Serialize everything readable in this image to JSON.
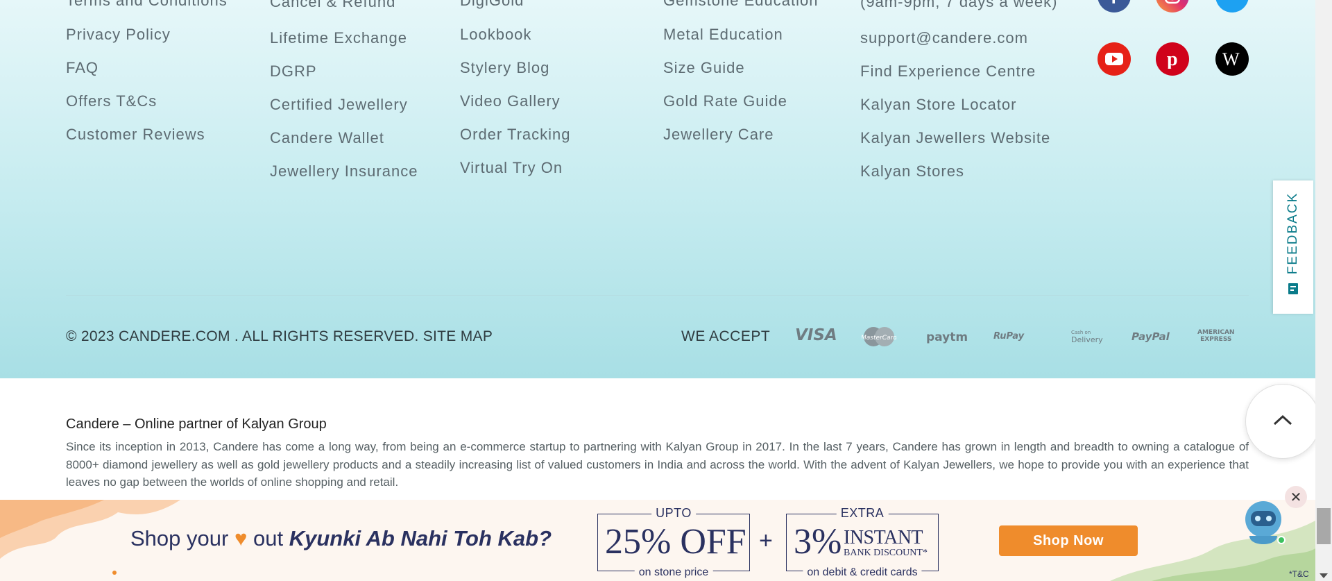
{
  "footer": {
    "columns": [
      {
        "id": "policies",
        "links": [
          "Terms and Conditions",
          "Privacy Policy",
          "FAQ",
          "Offers T&Cs",
          "Customer Reviews"
        ]
      },
      {
        "id": "services",
        "links": [
          "Cancel & Refund",
          "Lifetime Exchange",
          "DGRP",
          "Certified Jewellery",
          "Candere Wallet",
          "Jewellery Insurance"
        ]
      },
      {
        "id": "explore",
        "links": [
          "DigiGold",
          "Lookbook",
          "Stylery Blog",
          "Video Gallery",
          "Order Tracking",
          "Virtual Try On"
        ]
      },
      {
        "id": "education",
        "links": [
          "Gemstone Education",
          "Metal Education",
          "Size Guide",
          "Gold Rate Guide",
          "Jewellery Care"
        ]
      },
      {
        "id": "contact",
        "links": [
          "(9am-9pm, 7 days a week)",
          "support@candere.com",
          "Find Experience Centre",
          "Kalyan Store Locator",
          "Kalyan Jewellers Website",
          "Kalyan Stores"
        ]
      }
    ],
    "social": [
      {
        "name": "facebook-icon",
        "color": "#3b5998"
      },
      {
        "name": "instagram-icon",
        "color": "#e1306c"
      },
      {
        "name": "twitter-icon",
        "color": "#1da1f2"
      },
      {
        "name": "youtube-icon",
        "color": "#e62117"
      },
      {
        "name": "pinterest-icon",
        "color": "#d0021b"
      },
      {
        "name": "wikipedia-icon",
        "color": "#000000"
      }
    ],
    "copyright": "© 2023 CANDERE.COM . ALL RIGHTS RESERVED.",
    "sitemap_label": "SITE MAP",
    "we_accept_label": "WE ACCEPT",
    "payments": {
      "visa": "VISA",
      "mastercard": "MasterCard",
      "paytm": "paytm",
      "rupay": "RuPay",
      "cod_small": "Cash on",
      "cod": "Delivery",
      "paypal": "PayPal",
      "amex_line1": "AMERICAN",
      "amex_line2": "EXPRESS"
    }
  },
  "feedback": {
    "label": "FEEDBACK",
    "color": "#0a7b8a"
  },
  "about": {
    "title": "Candere – Online partner of Kalyan Group",
    "text": "Since its inception in 2013, Candere has come a long way, from being an e-commerce startup to partnering with Kalyan Group in 2017. In the last 7 years, Candere has grown in length and breadth to owning a catalogue of 8000+ diamond jewellery as well as gold jewellery products and a steadily increasing list of valued customers in India and across the world. With the advent of Kalyan Jewellers, we hope to provide you with an experience that leaves no gap between the worlds of online shopping and retail."
  },
  "banner": {
    "shop_your": "Shop your",
    "heart": "♥",
    "out": "out",
    "tagline": "Kyunki Ab Nahi Toh Kab?",
    "offer1_cap": "UPTO",
    "offer1_big": "25% OFF",
    "offer1_foot": "on stone price",
    "plus": "+",
    "offer2_cap": "EXTRA",
    "offer2_big": "3%",
    "offer2_instant": "INSTANT",
    "offer2_bank": "BANK DISCOUNT*",
    "offer2_foot": "on debit & credit cards",
    "shop_now": "Shop Now",
    "tnc": "*T&C",
    "accent": "#ef8c2c",
    "navy": "#2a3160"
  },
  "chat": {
    "close": "✕"
  }
}
